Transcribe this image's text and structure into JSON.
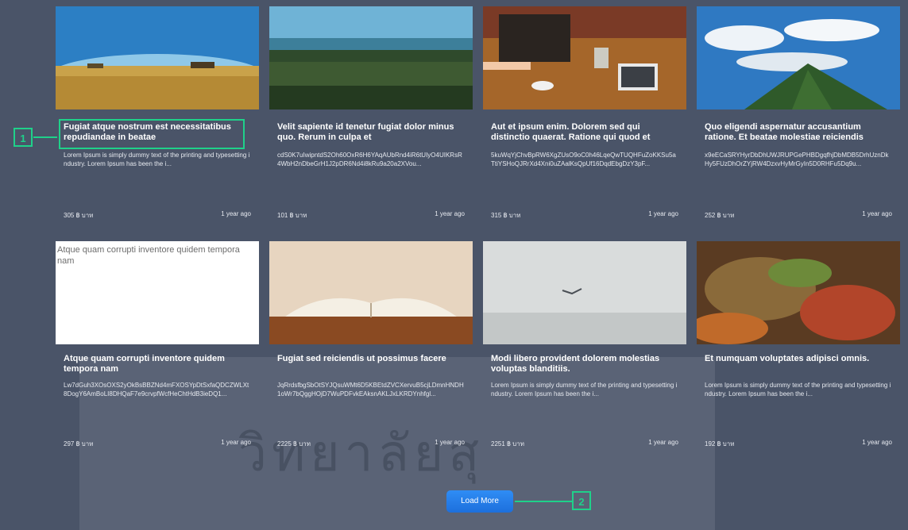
{
  "callout_markers": {
    "marker_1": "1",
    "marker_2": "2"
  },
  "cards": [
    {
      "title": "Fugiat atque nostrum est necessitatibus repudiandae in beatae",
      "desc": "Lorem Ipsum is simply dummy text of the printing and typesetting industry. Lorem Ipsum has been the i...",
      "price": "305 ฿ บาท",
      "time": "1 year ago",
      "image": "wheat-field-photo"
    },
    {
      "title": "Velit sapiente id tenetur fugiat dolor minus quo. Rerum in culpa et",
      "desc": "cdS0K7uIwipntdS2Oh60OxR6H6YAqAUbRnd4iR6tUIyO4UIKRsR4WbH2nDbeGrH1J2pDR6Nd4i8kRu9a20a2XVou...",
      "price": "101 ฿ บาท",
      "time": "1 year ago",
      "image": "forest-lake-photo"
    },
    {
      "title": "Aut et ipsum enim. Dolorem sed qui distinctio quaerat. Ratione qui quod et",
      "desc": "5kuWqYjChvBpRW6XgZUsO9oC0h46LqeQwTUQHFuZoKKSu5aTtiYSHoQJRrXd4Xni0uZAalKsQpUf16DqdEbgDzY3pF...",
      "price": "315 ฿ บาท",
      "time": "1 year ago",
      "image": "meeting-table-photo"
    },
    {
      "title": "Quo eligendi aspernatur accusantium ratione. Et beatae molestiae reiciendis",
      "desc": "x9eECaSRYHyrDbDhUWJRUPGePHBDgqfhjDbMDB5DrhUznDkHy5FUzDhOrZYjRW4DzxvHyMrGyIn5D0RHFu5Dq9u...",
      "price": "252 ฿ บาท",
      "time": "1 year ago",
      "image": "mountain-sky-photo"
    },
    {
      "title": "Atque quam corrupti inventore quidem tempora nam",
      "desc": "Lw7dGuh3XOsOXS2yOkBsBBZNd4mFXOSYpDtSxfaQDCZWLXt8DogY6AmBoLI8DHQaF7e9crvpfWcfHeChtHdB3ieDQ1...",
      "price": "297 ฿ บาท",
      "time": "1 year ago",
      "image": "broken-image",
      "alt": "Atque quam corrupti inventore quidem tempora nam"
    },
    {
      "title": "Fugiat sed reiciendis ut possimus facere",
      "desc": "JqRrdsfbgSbOtSYJQsuWMt6D5KBEtdZVCXervuB5cjLDmnHNDH1oWr7bQggHOjD7WuPDFvkEAksnAKLJxLKRDYnhfgl...",
      "price": "2225 ฿ บาท",
      "time": "1 year ago",
      "image": "open-book-photo"
    },
    {
      "title": "Modi libero provident dolorem molestias voluptas blanditiis.",
      "desc": "Lorem Ipsum is simply dummy text of the printing and typesetting industry. Lorem Ipsum has been the i...",
      "price": "2251 ฿ บาท",
      "time": "1 year ago",
      "image": "foggy-sky-bird-photo"
    },
    {
      "title": "Et numquam voluptates adipisci omnis.",
      "desc": "Lorem Ipsum is simply dummy text of the printing and typesetting industry. Lorem Ipsum has been the i...",
      "price": "192 ฿ บาท",
      "time": "1 year ago",
      "image": "autumn-leaves-photo"
    }
  ],
  "load_more": {
    "label": "Load More"
  },
  "watermark_text": "วิทยาลัยสุ",
  "colors": {
    "page_bg": "#4a5468",
    "accent": "#1fd18a",
    "button": "#1d6fdc"
  }
}
